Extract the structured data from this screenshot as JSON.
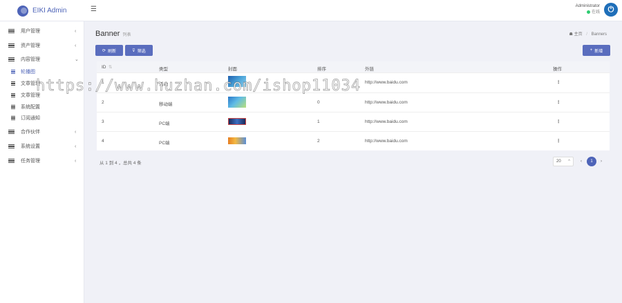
{
  "app": {
    "title": "EIKI Admin"
  },
  "header": {
    "menu_icon": "menu-icon",
    "user_name": "Administrator",
    "user_status": "在线",
    "logout_icon": "power-icon"
  },
  "sidebar": {
    "items": [
      {
        "label": "用户管理",
        "icon": "list-icon",
        "expanded": false
      },
      {
        "label": "资产管理",
        "icon": "list-icon",
        "expanded": false
      },
      {
        "label": "内容管理",
        "icon": "list-icon",
        "expanded": true
      },
      {
        "label": "轮播图",
        "icon": "list-icon",
        "active": true
      },
      {
        "label": "文章管理",
        "icon": "list-icon"
      },
      {
        "label": "文章管理",
        "icon": "list-icon"
      },
      {
        "label": "系统配置",
        "icon": "bar-chart-icon"
      },
      {
        "label": "订阅通知",
        "icon": "bar-chart-icon"
      },
      {
        "label": "合作伙伴",
        "icon": "list-icon",
        "expanded": false
      },
      {
        "label": "系统设置",
        "icon": "list-icon",
        "expanded": false
      },
      {
        "label": "任务管理",
        "icon": "card-icon",
        "expanded": false
      }
    ]
  },
  "page": {
    "title": "Banner",
    "subtitle": "列表",
    "breadcrumb_home": "主页",
    "breadcrumb_sep": "/",
    "breadcrumb_current": "Banners"
  },
  "toolbar": {
    "refresh_label": "刷新",
    "filter_label": "筛选",
    "add_label": "新增"
  },
  "table": {
    "headers": [
      "ID",
      "类型",
      "封面",
      "排序",
      "外链",
      "操作"
    ],
    "rows": [
      {
        "id": "1",
        "type": "活动",
        "sort": "",
        "link": "http://www.baidu.com",
        "action": "⋮"
      },
      {
        "id": "2",
        "type": "移动端",
        "sort": "0",
        "link": "http://www.baidu.com",
        "action": "⋮"
      },
      {
        "id": "3",
        "type": "PC端",
        "sort": "1",
        "link": "http://www.baidu.com",
        "action": "⋮"
      },
      {
        "id": "4",
        "type": "PC端",
        "sort": "2",
        "link": "http://www.baidu.com",
        "action": "⋮"
      }
    ]
  },
  "pagination": {
    "summary": "从 1 到 4 ，总共 4 条",
    "page_size": "20",
    "current": "1"
  },
  "watermark": "https://www.huzhan.com/ishop11034",
  "colors": {
    "accent": "#4e64b8",
    "button": "#5a6dbe",
    "online": "#2ecc71",
    "power": "#1f6fb9"
  }
}
